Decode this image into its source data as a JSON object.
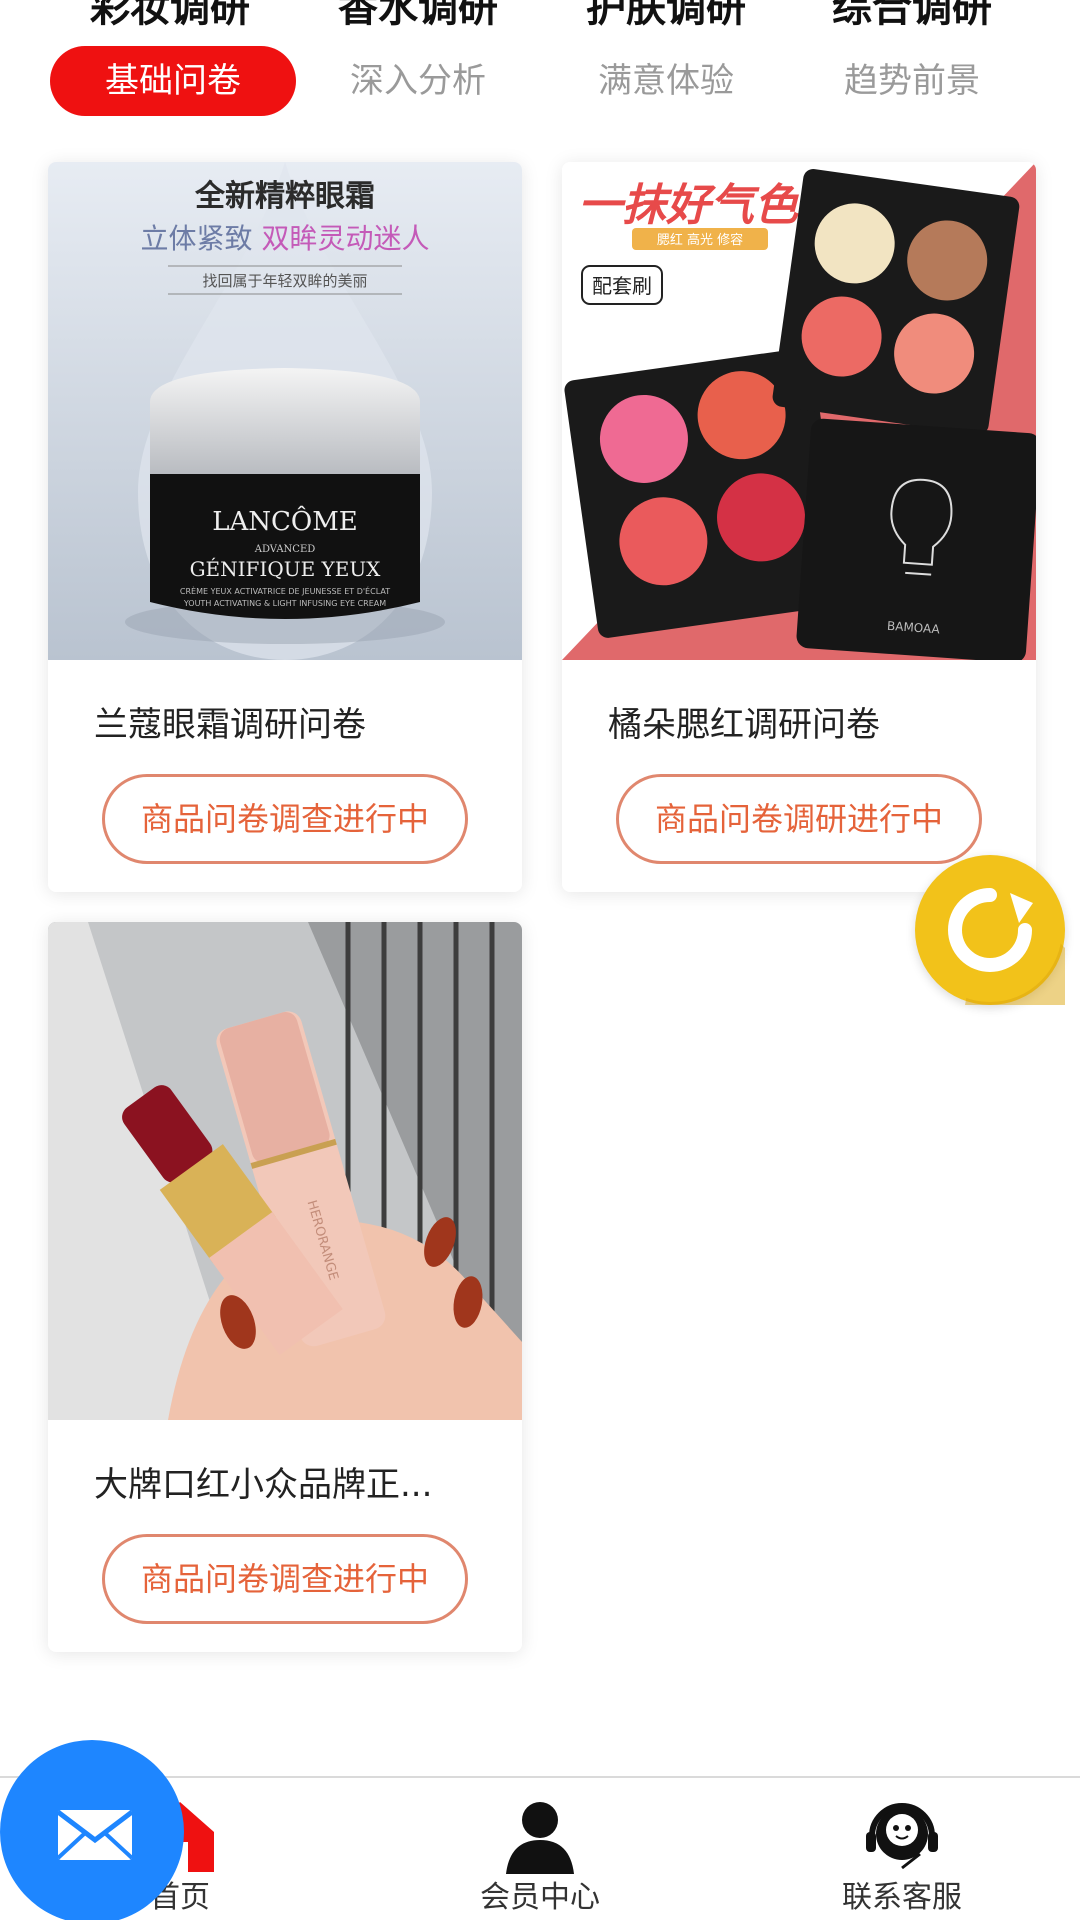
{
  "categories": [
    {
      "title": "彩妆调研",
      "sub": "基础问卷",
      "active": true
    },
    {
      "title": "香水调研",
      "sub": "深入分析",
      "active": false
    },
    {
      "title": "护肤调研",
      "sub": "满意体验",
      "active": false
    },
    {
      "title": "综合调研",
      "sub": "趋势前景",
      "active": false
    }
  ],
  "products": [
    {
      "title": "兰蔻眼霜调研问卷",
      "status": "商品问卷调查进行中",
      "image": {
        "headline": "全新精粹眼霜",
        "subline_a": "立体紧致 ",
        "subline_b": "双眸灵动迷人",
        "caption": "找回属于年轻双眸的美丽",
        "brand": "LANCÔME",
        "label_small": "ADVANCED",
        "product": "GÉNIFIQUE YEUX",
        "desc1": "CRÈME YEUX ACTIVATRICE DE JEUNESSE ET D'ÉCLAT",
        "desc2": "YOUTH ACTIVATING & LIGHT INFUSING EYE CREAM"
      }
    },
    {
      "title": "橘朵腮红调研问卷",
      "status": "商品问卷调研进行中",
      "image": {
        "headline": "一抹好气色",
        "tag": "腮红 高光 修容",
        "brush": "配套刷",
        "brand": "BAMOAA"
      }
    },
    {
      "title": "大牌口红小众品牌正...",
      "status": "商品问卷调查进行中",
      "image": {
        "brand": "HERORANGE"
      }
    }
  ],
  "nav": [
    {
      "label": "首页",
      "icon": "home-icon"
    },
    {
      "label": "会员中心",
      "icon": "user-icon"
    },
    {
      "label": "联系客服",
      "icon": "headset-icon"
    }
  ],
  "colors": {
    "accent": "#ef1111",
    "button_outline": "#e0876e",
    "button_text": "#e5633a",
    "refresh_fab": "#f2c21a",
    "mail_fab": "#1e86ff"
  },
  "icons": {
    "refresh": "refresh-icon",
    "mail": "mail-icon"
  }
}
